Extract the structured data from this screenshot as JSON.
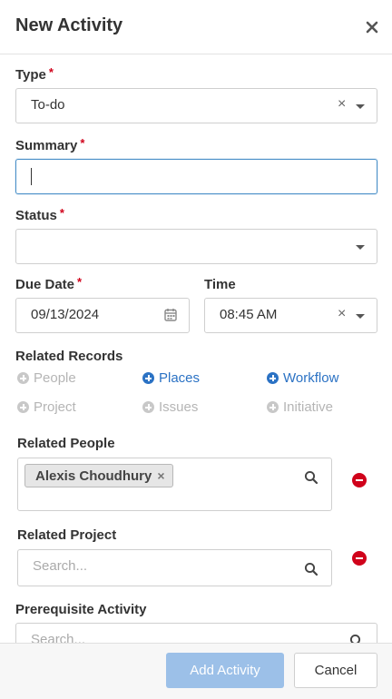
{
  "dialog": {
    "title": "New Activity",
    "close_icon": "close-icon"
  },
  "type": {
    "label": "Type",
    "required": "*",
    "value": "To-do",
    "clear": "×"
  },
  "summary": {
    "label": "Summary",
    "required": "*",
    "value": ""
  },
  "status": {
    "label": "Status",
    "required": "*",
    "value": ""
  },
  "due_date": {
    "label": "Due Date",
    "required": "*",
    "value": "09/13/2024",
    "icon": "calendar-icon"
  },
  "time": {
    "label": "Time",
    "value": "08:45 AM",
    "clear": "×"
  },
  "related_records": {
    "label": "Related Records",
    "items": [
      {
        "label": "People",
        "active": false
      },
      {
        "label": "Places",
        "active": true
      },
      {
        "label": "Workflow",
        "active": true
      },
      {
        "label": "Project",
        "active": false
      },
      {
        "label": "Issues",
        "active": false
      },
      {
        "label": "Initiative",
        "active": false
      }
    ]
  },
  "related_people": {
    "label": "Related People",
    "tags": [
      "Alexis Choudhury"
    ],
    "tag_remove": "×"
  },
  "related_project": {
    "label": "Related Project",
    "placeholder": "Search..."
  },
  "prerequisite": {
    "label": "Prerequisite Activity",
    "placeholder": "Search..."
  },
  "footer": {
    "primary": "Add Activity",
    "secondary": "Cancel"
  },
  "colors": {
    "link": "#2b72c4",
    "required": "#d0021b",
    "primary_button": "#9cc0e8"
  }
}
